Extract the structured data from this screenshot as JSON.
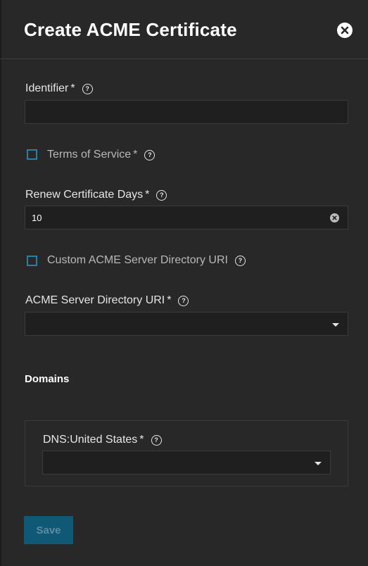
{
  "dialog": {
    "title": "Create ACME Certificate",
    "close_icon": "close-icon"
  },
  "form": {
    "identifier": {
      "label": "Identifier",
      "required": "*",
      "value": ""
    },
    "terms_of_service": {
      "label": "Terms of Service",
      "required": "*",
      "checked": false
    },
    "renew_days": {
      "label": "Renew Certificate Days",
      "required": "*",
      "value": "10"
    },
    "custom_uri": {
      "label": "Custom ACME Server Directory URI",
      "checked": false
    },
    "directory_uri": {
      "label": "ACME Server Directory URI",
      "required": "*",
      "value": ""
    }
  },
  "domains": {
    "section_title": "Domains",
    "items": [
      {
        "label": "DNS:United States",
        "required": "*",
        "value": ""
      }
    ]
  },
  "actions": {
    "save_label": "Save",
    "save_enabled": false
  },
  "colors": {
    "background": "#282828",
    "input_bg": "#1f1f1f",
    "checkbox_accent": "#2a7fa7",
    "save_button": "#0f5876"
  }
}
